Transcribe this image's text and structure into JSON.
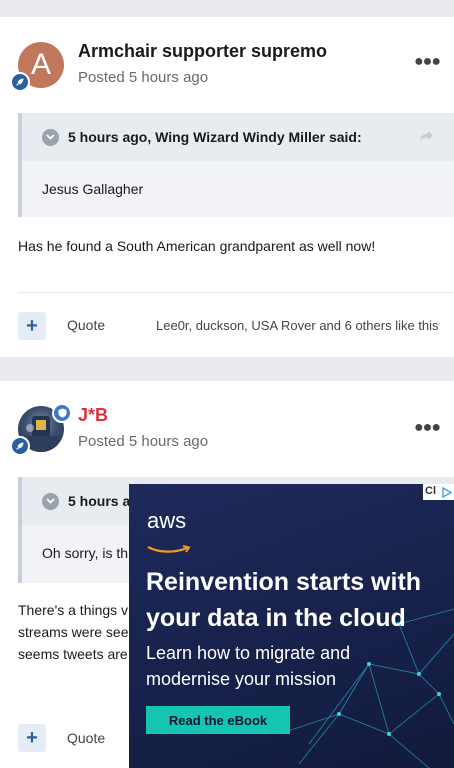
{
  "posts": [
    {
      "avatar_letter": "A",
      "author": "Armchair supporter supremo",
      "posted": "Posted 5 hours ago",
      "quote": {
        "header": "5 hours ago, Wing Wizard Windy Miller said:",
        "body": "Jesus Gallagher"
      },
      "content": "Has he found a South American grandparent as well now!",
      "quote_label": "Quote",
      "likes": "Lee0r, duckson, USA Rover and 6 others like this"
    },
    {
      "author": "J*B",
      "posted": "Posted 5 hours ago",
      "quote": {
        "header": "5 hours ag",
        "body": "Oh sorry, is th"
      },
      "content_lines": [
        "There's a things v",
        "streams were see",
        "seems tweets are"
      ],
      "quote_label": "Quote"
    }
  ],
  "ad": {
    "logo": "aws",
    "headline_1": "Reinvention starts with",
    "headline_2": "your data in the cloud",
    "sub_1": "Learn how to migrate and",
    "sub_2": "modernise your mission",
    "button": "Read the eBook",
    "close_label": "Cl"
  },
  "colors": {
    "accent": "#2c5f9e",
    "author_red": "#d8323c",
    "ad_bg": "#1f2a5c",
    "ad_button": "#14c6b1"
  },
  "icons": {
    "more": "more-dots-icon",
    "rank": "rocket-icon",
    "moderator": "shield-icon",
    "quote_toggle": "chevron-down-icon",
    "share": "share-arrow-icon",
    "react": "plus-icon"
  }
}
